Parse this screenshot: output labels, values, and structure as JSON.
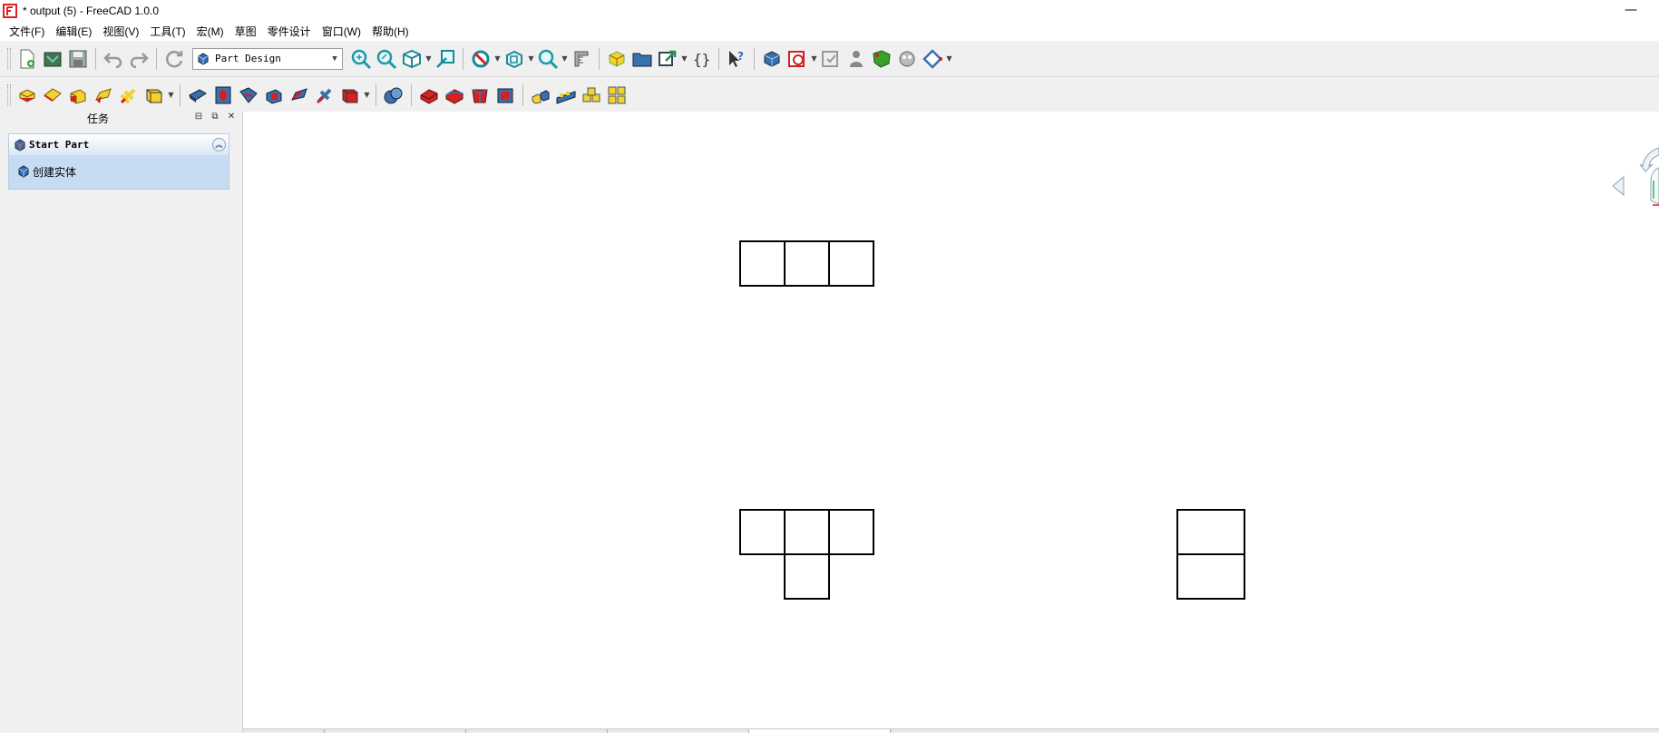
{
  "window": {
    "title": "* output (5) - FreeCAD 1.0.0",
    "minimize_glyph": "—"
  },
  "menubar": {
    "items": [
      "文件(F)",
      "编辑(E)",
      "视图(V)",
      "工具(T)",
      "宏(M)",
      "草图",
      "零件设计",
      "窗口(W)",
      "帮助(H)"
    ]
  },
  "toolbar": {
    "workbench_selector": "Part Design"
  },
  "task_panel": {
    "title": "任务",
    "box_title": "Start Part",
    "box_item": "创建实体"
  },
  "icons": {
    "app": "freecad-logo-icon",
    "collapse": "double-chevron-up-icon"
  },
  "colors": {
    "accent_blue": "#3a6fb0",
    "box_bg": "#c6dcf2",
    "part_yellow": "#f2d22e",
    "part_red": "#d42222"
  }
}
